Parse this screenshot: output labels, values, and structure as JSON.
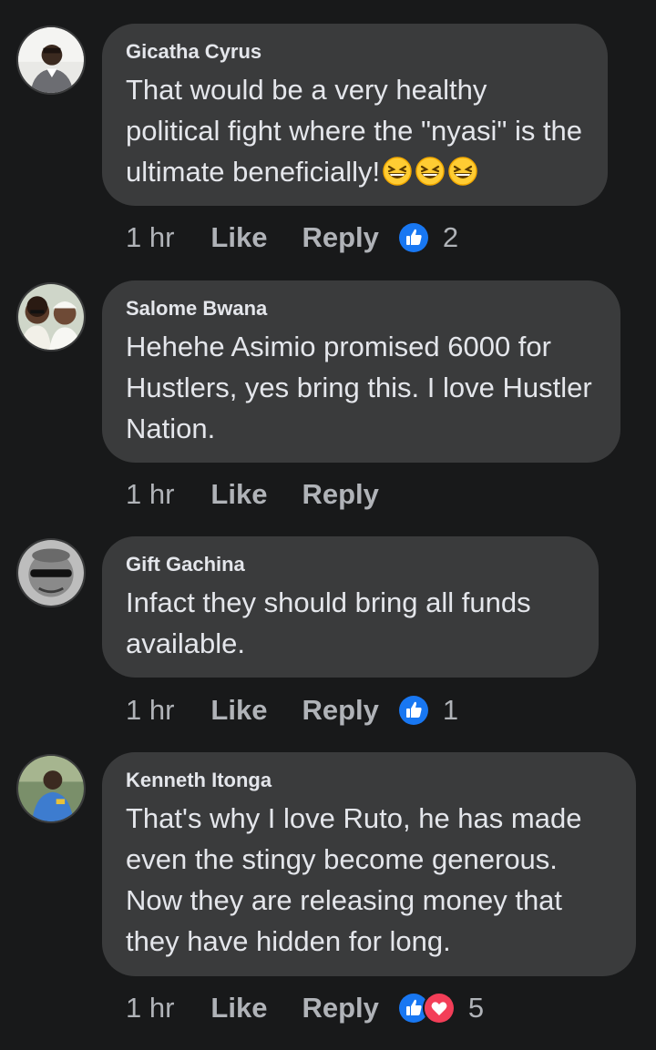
{
  "comments": [
    {
      "author": "Gicatha Cyrus",
      "text": "That would be a very healthy political fight where the \"nyasi\" is the ultimate beneficially!",
      "emojis": [
        "grinning-squinting-face",
        "grinning-squinting-face",
        "grinning-squinting-face"
      ],
      "time": "1 hr",
      "like_label": "Like",
      "reply_label": "Reply",
      "reactions": [
        "like-reaction"
      ],
      "reaction_count": "2"
    },
    {
      "author": "Salome Bwana",
      "text": "Hehehe Asimio promised 6000 for Hustlers, yes bring this. I love Hustler Nation.",
      "time": "1 hr",
      "like_label": "Like",
      "reply_label": "Reply"
    },
    {
      "author": "Gift Gachina",
      "text": "Infact they should bring all funds available.",
      "time": "1 hr",
      "like_label": "Like",
      "reply_label": "Reply",
      "reactions": [
        "like-reaction"
      ],
      "reaction_count": "1"
    },
    {
      "author": "Kenneth Itonga",
      "text": "That's why I love Ruto, he has made even the stingy become generous. Now they are releasing money that they have hidden for long.",
      "time": "1 hr",
      "like_label": "Like",
      "reply_label": "Reply",
      "reactions": [
        "like-reaction",
        "love-reaction"
      ],
      "reaction_count": "5"
    }
  ],
  "colors": {
    "background": "#18191a",
    "bubble": "#3a3b3c",
    "text": "#e4e6eb",
    "meta": "#b0b3b8",
    "like_blue": "#1877f2",
    "love_red": "#f33e58"
  }
}
